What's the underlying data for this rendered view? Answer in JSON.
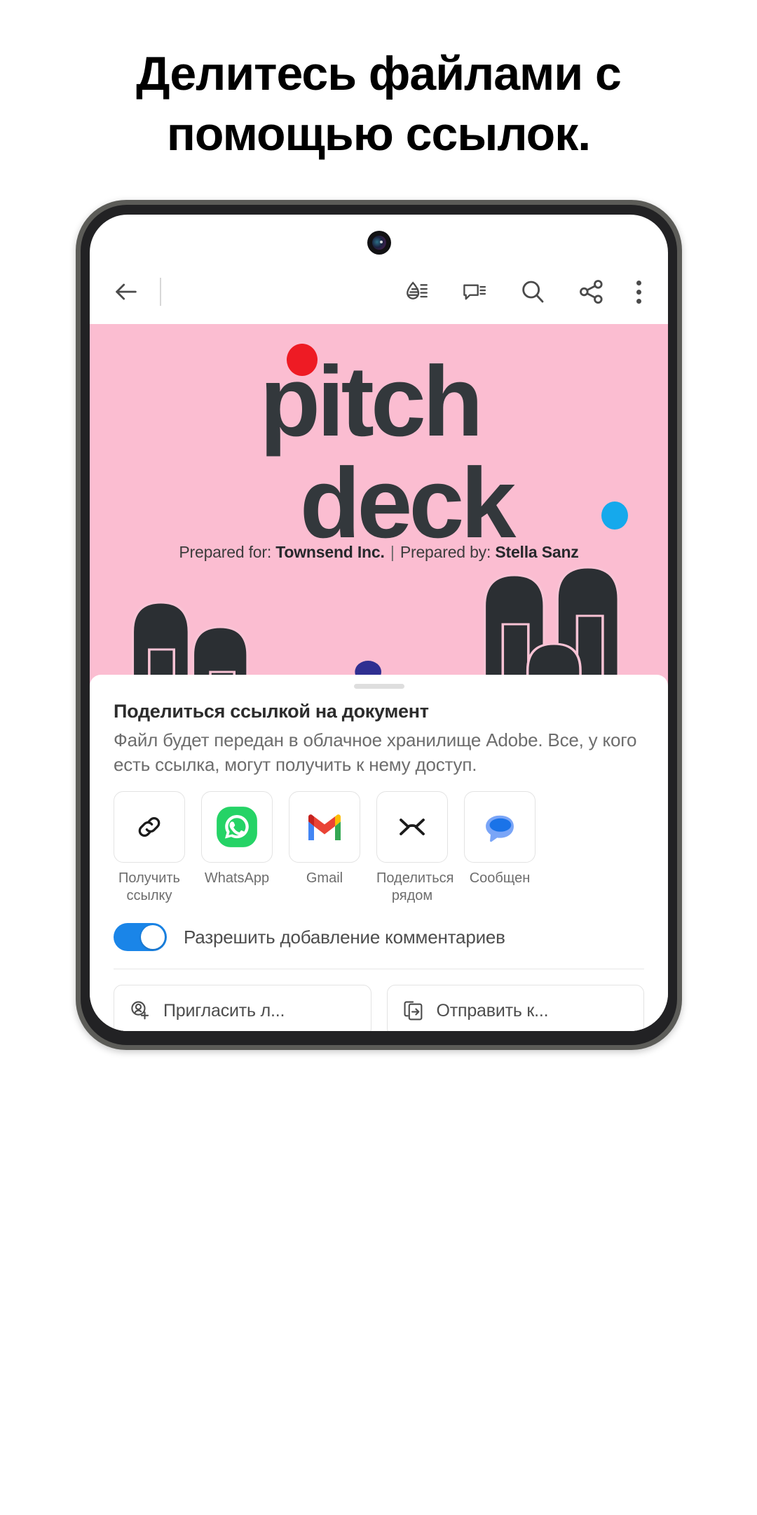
{
  "headline": {
    "line1": "Делитесь файлами с",
    "line2": "помощью ссылок."
  },
  "colors": {
    "cover_bg": "#fbbdd1",
    "cover_text": "#33383c",
    "accent_blue": "#1a85e8",
    "dot_red": "#ee1b24",
    "dot_blue": "#15a9ec",
    "dot_navy": "#2f2f91",
    "dot_magenta": "#e50b96",
    "whatsapp_green": "#25d366",
    "messages_blue": "#1a73e8",
    "phone_bezel_outer": "#5c5c58",
    "phone_bezel_inner": "#222224"
  },
  "appbar": {
    "back_icon": "arrow-left-icon",
    "tools": [
      {
        "name": "liquid-mode-icon",
        "label": "Liquid Mode"
      },
      {
        "name": "comment-icon",
        "label": "Комментарии"
      },
      {
        "name": "search-icon",
        "label": "Поиск"
      },
      {
        "name": "share-icon",
        "label": "Поделиться"
      },
      {
        "name": "overflow-menu-icon",
        "label": "Ещё"
      }
    ]
  },
  "document": {
    "title_line1": "pitch",
    "title_line2": "deck",
    "credit_prefix_for": "Prepared for:",
    "credit_company": "Townsend Inc.",
    "credit_separator": "|",
    "credit_prefix_by": "Prepared by:",
    "credit_author": "Stella Sanz"
  },
  "sheet": {
    "title": "Поделиться ссылкой на документ",
    "body": "Файл будет передан в облачное хранилище Adobe. Все, у кого есть ссылка, могут получить к нему доступ.",
    "targets": [
      {
        "icon": "link-icon",
        "label": "Получить ссылку"
      },
      {
        "icon": "whatsapp-icon",
        "label": "WhatsApp"
      },
      {
        "icon": "gmail-icon",
        "label": "Gmail"
      },
      {
        "icon": "nearby-share-icon",
        "label": "Поделиться рядом"
      },
      {
        "icon": "messages-icon",
        "label": "Сообщен"
      }
    ],
    "toggle": {
      "label": "Разрешить добавление комментариев",
      "state": "on"
    },
    "actions": [
      {
        "icon": "invite-person-icon",
        "label": "Пригласить л..."
      },
      {
        "icon": "send-copy-icon",
        "label": "Отправить к..."
      }
    ]
  }
}
